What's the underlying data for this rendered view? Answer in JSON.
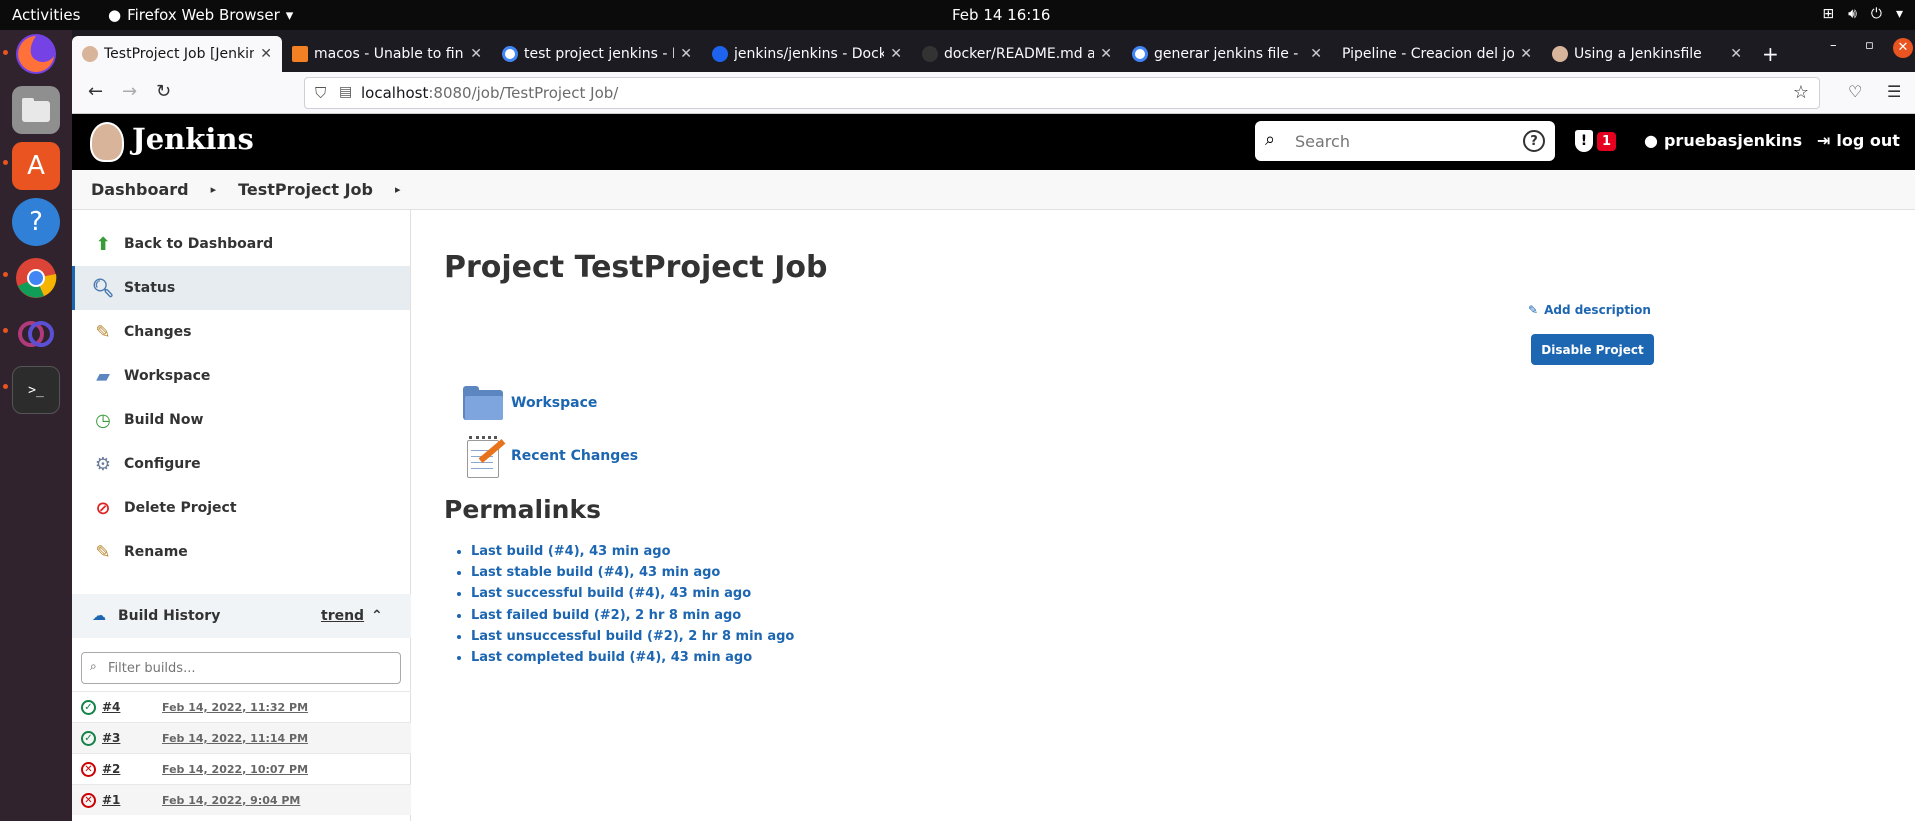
{
  "os": {
    "activities": "Activities",
    "app_menu": "Firefox Web Browser",
    "clock": "Feb 14  16:16"
  },
  "browser": {
    "tabs": [
      {
        "label": "TestProject Job [Jenkins]",
        "active": true
      },
      {
        "label": "macos - Unable to find",
        "active": false
      },
      {
        "label": "test project jenkins - Bu",
        "active": false
      },
      {
        "label": "jenkins/jenkins - Docker",
        "active": false
      },
      {
        "label": "docker/README.md at",
        "active": false
      },
      {
        "label": "generar jenkins file - Bu",
        "active": false
      },
      {
        "label": "Pipeline - Creacion del job",
        "active": false
      },
      {
        "label": "Using a Jenkinsfile",
        "active": false
      }
    ],
    "url_host": "localhost",
    "url_path": ":8080/job/TestProject Job/"
  },
  "jenkins": {
    "title": "Jenkins",
    "search_placeholder": "Search",
    "alert_count": "1",
    "user": "pruebasjenkins",
    "logout": "log out"
  },
  "breadcrumb": [
    "Dashboard",
    "TestProject Job"
  ],
  "sidebar": {
    "items": [
      {
        "label": "Back to Dashboard",
        "icon": "up-arrow-icon"
      },
      {
        "label": "Status",
        "icon": "magnifier-icon"
      },
      {
        "label": "Changes",
        "icon": "notepad-icon"
      },
      {
        "label": "Workspace",
        "icon": "folder-icon"
      },
      {
        "label": "Build Now",
        "icon": "clock-icon"
      },
      {
        "label": "Configure",
        "icon": "gear-icon"
      },
      {
        "label": "Delete Project",
        "icon": "no-entry-icon"
      },
      {
        "label": "Rename",
        "icon": "notepad-icon"
      }
    ]
  },
  "build_history": {
    "title": "Build History",
    "trend": "trend",
    "filter_placeholder": "Filter builds...",
    "builds": [
      {
        "number": "#4",
        "date": "Feb 14, 2022, 11:32 PM",
        "status": "success"
      },
      {
        "number": "#3",
        "date": "Feb 14, 2022, 11:14 PM",
        "status": "success"
      },
      {
        "number": "#2",
        "date": "Feb 14, 2022, 10:07 PM",
        "status": "failed"
      },
      {
        "number": "#1",
        "date": "Feb 14, 2022, 9:04 PM",
        "status": "failed"
      }
    ]
  },
  "main": {
    "title": "Project TestProject Job",
    "add_description": "Add description",
    "disable_button": "Disable Project",
    "workspace_link": "Workspace",
    "recent_changes_link": "Recent Changes",
    "permalinks_title": "Permalinks",
    "permalinks": [
      "Last build (#4), 43 min ago",
      "Last stable build (#4), 43 min ago",
      "Last successful build (#4), 43 min ago",
      "Last failed build (#2), 2 hr 8 min ago",
      "Last unsuccessful build (#2), 2 hr 8 min ago",
      "Last completed build (#4), 43 min ago"
    ]
  },
  "colors": {
    "jenkins_link": "#1d66b1",
    "success": "#138347",
    "failure": "#cc0003",
    "alert": "#e6001f"
  }
}
